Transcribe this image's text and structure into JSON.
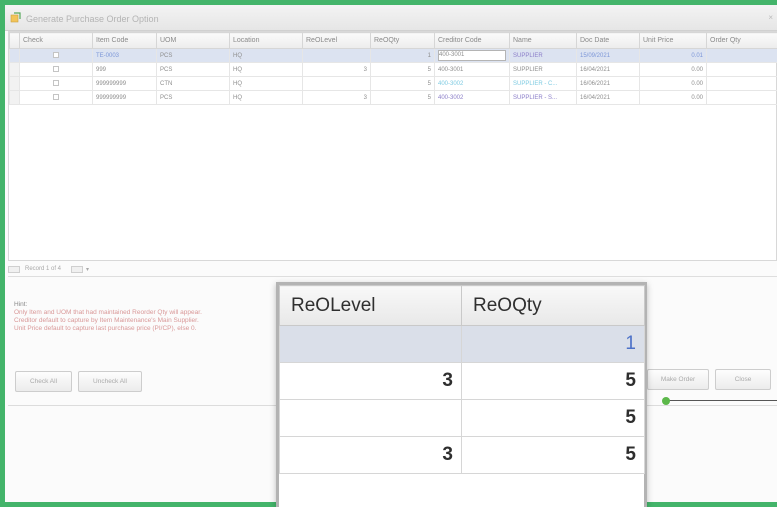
{
  "window": {
    "title": "Generate Purchase Order Option",
    "close_glyph": "×"
  },
  "grid": {
    "columns": [
      "Check",
      "Item Code",
      "UOM",
      "Location",
      "ReOLevel",
      "ReOQty",
      "Creditor Code",
      "Name",
      "Doc Date",
      "Unit Price",
      "Order Qty"
    ],
    "rows": [
      {
        "check": "",
        "item_code": "TE-0003",
        "uom": "PCS",
        "location": "HQ",
        "reo_level": "",
        "reo_qty": "1",
        "creditor_code": "400-3001",
        "name": "SUPPLIER",
        "doc_date": "15/09/2021",
        "unit_price": "0.01",
        "order_qty": ""
      },
      {
        "check": "",
        "item_code": "999",
        "uom": "PCS",
        "location": "HQ",
        "reo_level": "3",
        "reo_qty": "5",
        "creditor_code": "400-3001",
        "name": "SUPPLIER",
        "doc_date": "16/04/2021",
        "unit_price": "0.00",
        "order_qty": ""
      },
      {
        "check": "",
        "item_code": "999999999",
        "uom": "CTN",
        "location": "HQ",
        "reo_level": "",
        "reo_qty": "5",
        "creditor_code": "400-3002",
        "name": "SUPPLIER - C...",
        "doc_date": "16/06/2021",
        "unit_price": "0.00",
        "order_qty": ""
      },
      {
        "check": "",
        "item_code": "999999999",
        "uom": "PCS",
        "location": "HQ",
        "reo_level": "3",
        "reo_qty": "5",
        "creditor_code": "400-3002",
        "name": "SUPPLIER - S...",
        "doc_date": "16/04/2021",
        "unit_price": "0.00",
        "order_qty": ""
      }
    ]
  },
  "navigator": {
    "record_text": "Record 1 of 4"
  },
  "note": {
    "header": "Hint:",
    "lines": [
      "Only Item and UOM that had maintained Reorder Qty will appear.",
      "Creditor default to capture by Item Maintenance's Main Supplier.",
      "Unit Price default to capture last purchase price (PI/CP), else 0."
    ]
  },
  "buttons": {
    "check_all": "Check All",
    "uncheck_all": "Uncheck All",
    "make_order": "Make Order",
    "close": "Close"
  },
  "zoom": {
    "columns": [
      "ReOLevel",
      "ReOQty"
    ],
    "rows": [
      {
        "reo_level": "",
        "reo_qty": "1"
      },
      {
        "reo_level": "3",
        "reo_qty": "5"
      },
      {
        "reo_level": "",
        "reo_qty": "5"
      },
      {
        "reo_level": "3",
        "reo_qty": "5"
      }
    ]
  },
  "colors": {
    "frame_border": "#43b46a",
    "selection": "#dce3f1",
    "link_blue": "#4d72c8",
    "connector_dot": "#5cb84a"
  }
}
